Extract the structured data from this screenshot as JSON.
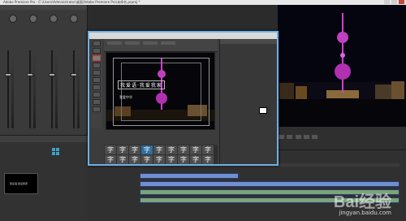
{
  "window": {
    "title": "Adobe Premiere Pro - C:\\Users\\Administrator\\桌面\\Adobe Premiere Pro\\未命名.prproj *"
  },
  "title_designer": {
    "main_caption": "我爱语·我爱我家",
    "sub_caption": "我爱中华",
    "style_glyph": "字",
    "style_count": 18,
    "selected_style_index": 3
  },
  "watermark": {
    "brand": "Bai经验",
    "url": "jingyan.baidu.com"
  },
  "colors": {
    "accent": "#6bb0e8",
    "highlight_box": "#d23c3c",
    "property_value": "#e6a23c",
    "tower_magenta": "#d040d0"
  }
}
